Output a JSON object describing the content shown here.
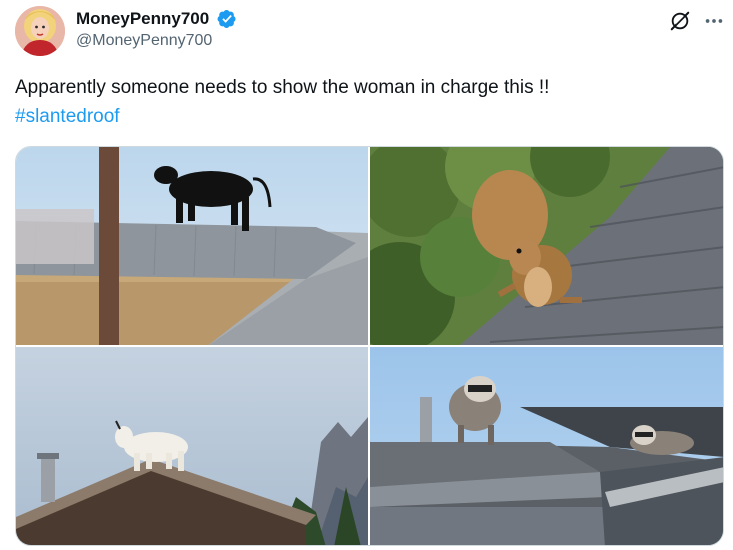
{
  "post": {
    "display_name": "MoneyPenny700",
    "handle": "@MoneyPenny700",
    "text": "Apparently someone needs to show the woman in charge this !!",
    "hashtag": "#slantedroof"
  },
  "icons": {
    "verified": "verified-badge-icon",
    "grok": "grok-icon",
    "more": "more-options-icon"
  },
  "media": {
    "photos": [
      {
        "subject": "cow-on-roof"
      },
      {
        "subject": "squirrel-on-roof"
      },
      {
        "subject": "goat-on-roof"
      },
      {
        "subject": "raccoons-on-roof"
      }
    ]
  },
  "colors": {
    "link": "#1d9bf0",
    "verified": "#1d9bf0",
    "secondary_text": "#536471"
  }
}
